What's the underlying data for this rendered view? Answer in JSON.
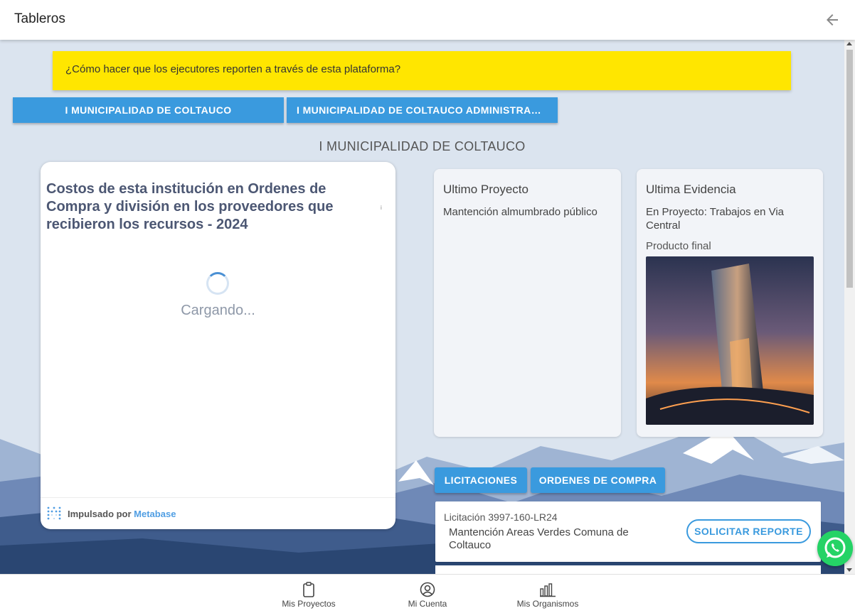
{
  "header": {
    "title": "Tableros",
    "back_icon": "arrow-left-icon"
  },
  "banner": {
    "text": "¿Cómo hacer que los ejecutores reporten a través de esta plataforma?",
    "color": "#ffe600"
  },
  "institutions": [
    {
      "label": "I MUNICIPALIDAD DE COLTAUCO"
    },
    {
      "label": "I MUNICIPALIDAD DE COLTAUCO ADMINISTRACI..."
    }
  ],
  "section_title": "I MUNICIPALIDAD DE COLTAUCO",
  "metabase": {
    "title": "Costos de esta institución en Ordenes de Compra y división en los proveedores que recibieron los recursos - 2024",
    "info": "i",
    "loading": "Cargando...",
    "powered_prefix": "Impulsado por ",
    "powered_brand": "Metabase"
  },
  "last_project": {
    "title": "Ultimo Proyecto",
    "name": "Mantención almumbrado público"
  },
  "last_evidence": {
    "title": "Ultima Evidencia",
    "project": "En Proyecto: Trabajos en Via Central",
    "label": "Producto final"
  },
  "tabs": [
    {
      "label": "LICITACIONES"
    },
    {
      "label": "ORDENES DE COMPRA"
    }
  ],
  "tender": {
    "code": "Licitación 3997-160-LR24",
    "description": "Mantención Areas Verdes Comuna de Coltauco",
    "action": "SOLICITAR REPORTE"
  },
  "bottom_nav": [
    {
      "label": "Mis Proyectos",
      "icon": "clipboard-icon"
    },
    {
      "label": "Mi Cuenta",
      "icon": "account-circle-icon"
    },
    {
      "label": "Mis Organismos",
      "icon": "bar-chart-icon"
    }
  ],
  "colors": {
    "accent": "#3a9ade",
    "background": "#dfe7f1",
    "whatsapp": "#25d366"
  }
}
